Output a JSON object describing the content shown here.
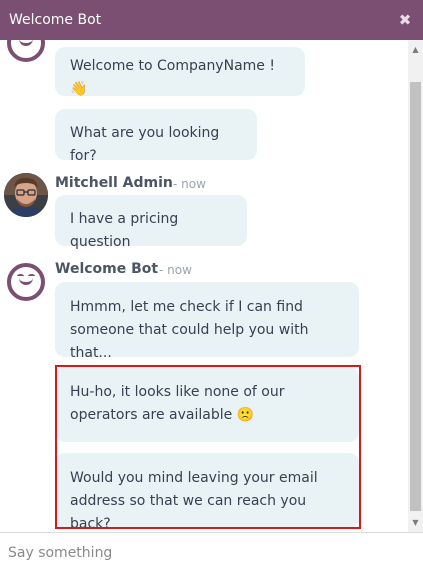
{
  "window": {
    "title": "Welcome Bot",
    "close_icon": "close-icon"
  },
  "messages": [
    {
      "author": "",
      "bubbles": [
        {
          "text": "Welcome to CompanyName ! 👋"
        },
        {
          "text": "What are you looking for?"
        }
      ]
    },
    {
      "author": "Mitchell Admin",
      "time": "- now",
      "bubbles": [
        {
          "text": "I have a pricing question"
        }
      ]
    },
    {
      "author": "Welcome Bot",
      "time": "- now",
      "bubbles": [
        {
          "text": "Hmmm, let me check if I can find someone that could help you with that..."
        },
        {
          "text": "Hu-ho, it looks like none of our operators are available 🙁"
        },
        {
          "text": "Would you mind leaving your email address so that we can reach you back?"
        }
      ]
    }
  ],
  "composer": {
    "placeholder": "Say something"
  },
  "colors": {
    "titlebar": "#7a4f72",
    "bubble": "#e9f2f5",
    "highlight_border": "#d51a1a"
  }
}
